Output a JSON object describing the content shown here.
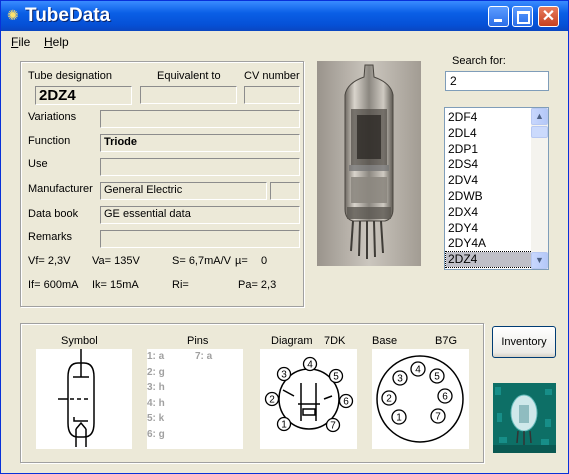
{
  "window": {
    "title": "TubeData"
  },
  "menu": {
    "file": "File",
    "help": "Help"
  },
  "labels": {
    "designation": "Tube designation",
    "equivalent": "Equivalent to",
    "cv": "CV number",
    "variations": "Variations",
    "function": "Function",
    "use": "Use",
    "manufacturer": "Manufacturer",
    "databook": "Data book",
    "remarks": "Remarks"
  },
  "values": {
    "designation": "2DZ4",
    "equivalent": "",
    "cv": "",
    "variations": "",
    "function": "Triode",
    "use": "",
    "manufacturer": "General Electric",
    "manufacturer_extra": "",
    "databook": "GE essential data",
    "remarks": ""
  },
  "specs": {
    "vf": "Vf= 2,3V",
    "va": "Va= 135V",
    "s": "S= 6,7mA/V",
    "mu": "µ=",
    "mu_val": "0",
    "if": "If= 600mA",
    "ik": "Ik=  15mA",
    "ri": "Ri=",
    "pa": "Pa= 2,3"
  },
  "search": {
    "label": "Search for:",
    "value": "2"
  },
  "list": {
    "items": [
      "2DF4",
      "2DL4",
      "2DP1",
      "2DS4",
      "2DV4",
      "2DWB",
      "2DX4",
      "2DY4",
      "2DY4A",
      "2DZ4"
    ],
    "selected_index": 9
  },
  "bottom": {
    "symbol": "Symbol",
    "pins": "Pins",
    "diagram": "Diagram",
    "diagram_code": "7DK",
    "base": "Base",
    "base_code": "B7G",
    "pins_left": [
      "1: a",
      "2: g",
      "3: h",
      "4: h",
      "5: k",
      "6: g"
    ],
    "pins_right": [
      "7: a"
    ]
  },
  "diagram_pins": [
    "1",
    "2",
    "3",
    "4",
    "5",
    "6",
    "7"
  ],
  "base_pins": [
    "1",
    "2",
    "3",
    "4",
    "5",
    "6",
    "7"
  ],
  "buttons": {
    "inventory": "Inventory"
  },
  "icons": {
    "app": "lightbulb-icon",
    "minimize": "minimize-icon",
    "maximize": "maximize-icon",
    "close": "close-icon",
    "scroll_up": "scroll-up-icon",
    "scroll_down": "scroll-down-icon"
  },
  "colors": {
    "titlebar": "#0a5fe6",
    "window_bg": "#ece9d8",
    "selection": "#c0c0c8",
    "close_button": "#c5401f"
  }
}
